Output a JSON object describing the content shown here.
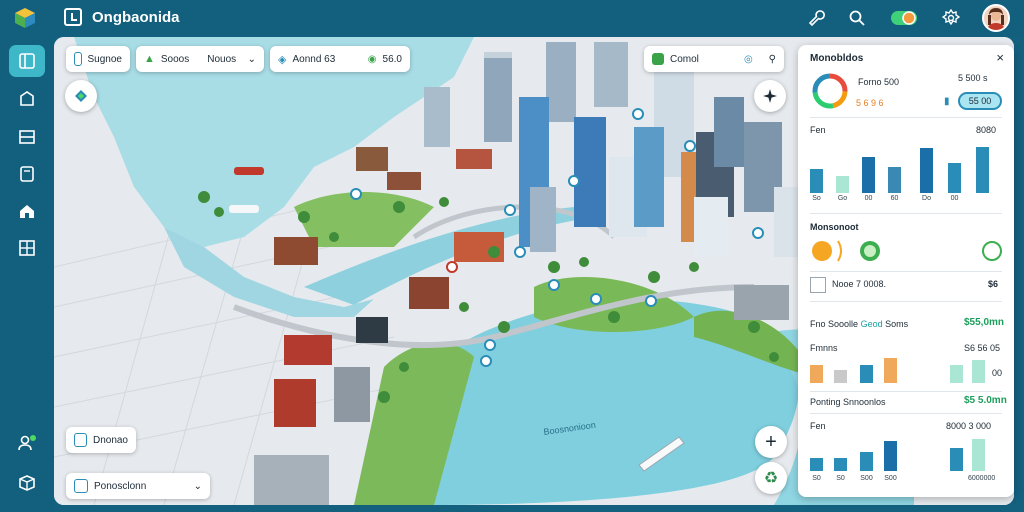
{
  "app": {
    "title": "Ongbaonida"
  },
  "topbar": {
    "icons": [
      "wrench-icon",
      "search-icon",
      "toggle-icon",
      "settings-icon",
      "avatar"
    ]
  },
  "sidebar": {
    "items": [
      {
        "name": "sidebar-item-dashboard",
        "icon": "panel-icon",
        "active": true
      },
      {
        "name": "sidebar-item-layers",
        "icon": "layers-icon",
        "active": false
      },
      {
        "name": "sidebar-item-list",
        "icon": "list-icon",
        "active": false
      },
      {
        "name": "sidebar-item-documents",
        "icon": "document-icon",
        "active": false
      },
      {
        "name": "sidebar-item-home",
        "icon": "home-icon",
        "active": false
      },
      {
        "name": "sidebar-item-grid",
        "icon": "grid-icon",
        "active": false
      },
      {
        "name": "sidebar-item-people",
        "icon": "people-icon",
        "active": false
      },
      {
        "name": "sidebar-item-box",
        "icon": "box-icon",
        "active": false
      }
    ]
  },
  "map_controls": {
    "chip1": "Sugnoe",
    "chip2_a": "Sooos",
    "chip2_b": "Nouos",
    "chip3_a": "Aonnd 63",
    "chip3_b": "56.0",
    "chip4": "Comol",
    "bottom_chip1": "Dnonao",
    "bottom_chip2": "Ponosclonn",
    "water_label": "Boosnonioon",
    "zoom_in": "+"
  },
  "panel": {
    "title": "Monobldos",
    "close": "×",
    "kpi_label": "Forno 500",
    "kpi_value": "5 500 s",
    "kpi_sub": "5 6 9 6",
    "kpi_pill": "55 00",
    "chart1_left": "Fen",
    "chart1_right": "8080",
    "chart1": {
      "values": [
        24,
        17,
        36,
        26,
        45,
        30,
        46
      ],
      "max": 50,
      "labels": [
        "So",
        "Go",
        "00",
        "60",
        "Do",
        "00",
        ""
      ]
    },
    "section2_title": "Monsonoot",
    "row_label": "Nooe 7 0008.",
    "row_value": "$6",
    "green_row_label": "Fno Sooolle",
    "green_row_label_accent": "Geod",
    "green_row_label_tail": "Soms",
    "green_row_value": "$55,0mn",
    "chart2_left": "Fmnns",
    "chart2_right": "S6 56 05",
    "chart2_value": "00",
    "chart2": {
      "values": [
        14,
        10,
        14,
        20,
        14,
        18
      ]
    },
    "section3_label": "Ponting Snnoonlos",
    "section3_value": "$5 5.0mn",
    "chart3_left": "Fen",
    "chart3_right": "8000 3 000",
    "chart3": {
      "values": [
        12,
        12,
        18,
        28,
        22,
        30
      ],
      "labels": [
        "S0",
        "S0",
        "S00",
        "S00",
        "",
        "6000000"
      ]
    }
  }
}
